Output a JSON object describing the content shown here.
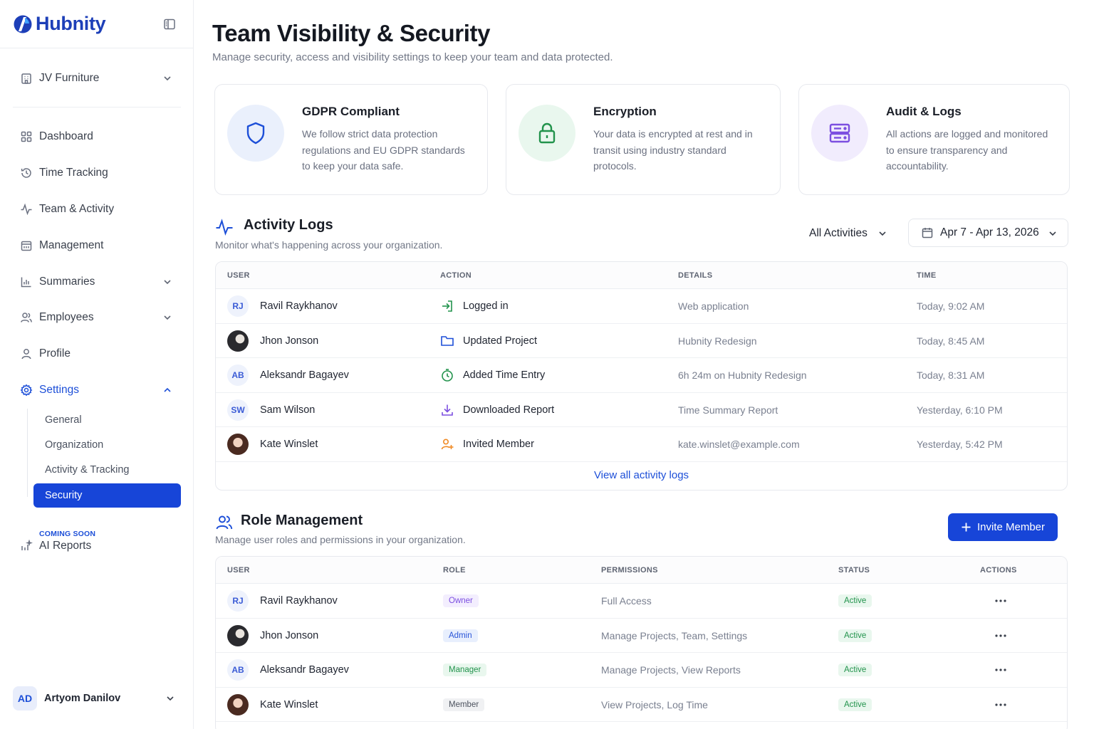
{
  "app": {
    "name": "Hubnity"
  },
  "colors": {
    "brand": "#1745d8",
    "green": "#22934c",
    "purple": "#7c4fe0"
  },
  "sidebar": {
    "org": {
      "label": "JV Furniture",
      "icon": "building-icon"
    },
    "nav": [
      {
        "label": "Dashboard",
        "icon": "grid-icon"
      },
      {
        "label": "Time Tracking",
        "icon": "clock-history-icon"
      },
      {
        "label": "Team & Activity",
        "icon": "pulse-icon"
      },
      {
        "label": "Management",
        "icon": "calendar-icon"
      },
      {
        "label": "Summaries",
        "icon": "bar-chart-icon"
      },
      {
        "label": "Employees",
        "icon": "users-icon"
      },
      {
        "label": "Profile",
        "icon": "user-icon"
      },
      {
        "label": "Settings",
        "icon": "gear-icon"
      }
    ],
    "settings_sub": [
      "General",
      "Organization",
      "Activity & Tracking",
      "Security"
    ],
    "coming_soon": "COMING SOON",
    "ai_reports": "AI Reports",
    "user": {
      "initials": "AD",
      "name": "Artyom Danilov"
    }
  },
  "header": {
    "title": "Team Visibility & Security",
    "subtitle": "Manage security, access and visibility settings to keep your team and data protected."
  },
  "cards": [
    {
      "title": "GDPR Compliant",
      "desc": "We follow strict data protection regulations and EU GDPR standards to keep your data safe.",
      "icon": "shield-icon"
    },
    {
      "title": "Encryption",
      "desc": "Your data is encrypted at rest and in transit using industry standard protocols.",
      "icon": "lock-icon"
    },
    {
      "title": "Audit & Logs",
      "desc": "All actions are logged and monitored to ensure transparency and accountability.",
      "icon": "server-icon"
    }
  ],
  "activity": {
    "title": "Activity Logs",
    "subtitle": "Monitor what's happening across your organization.",
    "filter": "All Activities",
    "date_range": "Apr 7 - Apr 13, 2026",
    "columns": [
      "USER",
      "ACTION",
      "DETAILS",
      "TIME"
    ],
    "rows": [
      {
        "initials": "RJ",
        "user": "Ravil Raykhanov",
        "action": "Logged in",
        "icon": "login-icon",
        "details": "Web application",
        "time": "Today, 9:02 AM"
      },
      {
        "initials": "",
        "user": "Jhon Jonson",
        "action": "Updated Project",
        "icon": "folder-icon",
        "details": "Hubnity Redesign",
        "time": "Today, 8:45 AM"
      },
      {
        "initials": "AB",
        "user": "Aleksandr Bagayev",
        "action": "Added Time Entry",
        "icon": "stopwatch-icon",
        "details": "6h 24m on Hubnity Redesign",
        "time": "Today, 8:31 AM"
      },
      {
        "initials": "SW",
        "user": "Sam Wilson",
        "action": "Downloaded Report",
        "icon": "download-icon",
        "details": "Time Summary Report",
        "time": "Yesterday, 6:10 PM"
      },
      {
        "initials": "",
        "user": "Kate Winslet",
        "action": "Invited Member",
        "icon": "user-plus-icon",
        "details": "kate.winslet@example.com",
        "time": "Yesterday, 5:42 PM"
      }
    ],
    "view_all": "View all activity logs"
  },
  "roles": {
    "title": "Role Management",
    "subtitle": "Manage user roles and permissions in your organization.",
    "invite_label": "Invite Member",
    "columns": [
      "USER",
      "ROLE",
      "PERMISSIONS",
      "STATUS",
      "ACTIONS"
    ],
    "rows": [
      {
        "initials": "RJ",
        "user": "Ravil Raykhanov",
        "role": "Owner",
        "permissions": "Full Access",
        "status": "Active"
      },
      {
        "initials": "",
        "user": "Jhon Jonson",
        "role": "Admin",
        "permissions": "Manage Projects, Team, Settings",
        "status": "Active"
      },
      {
        "initials": "AB",
        "user": "Aleksandr Bagayev",
        "role": "Manager",
        "permissions": "Manage Projects, View Reports",
        "status": "Active"
      },
      {
        "initials": "",
        "user": "Kate Winslet",
        "role": "Member",
        "permissions": "View Projects, Log Time",
        "status": "Active"
      }
    ]
  }
}
